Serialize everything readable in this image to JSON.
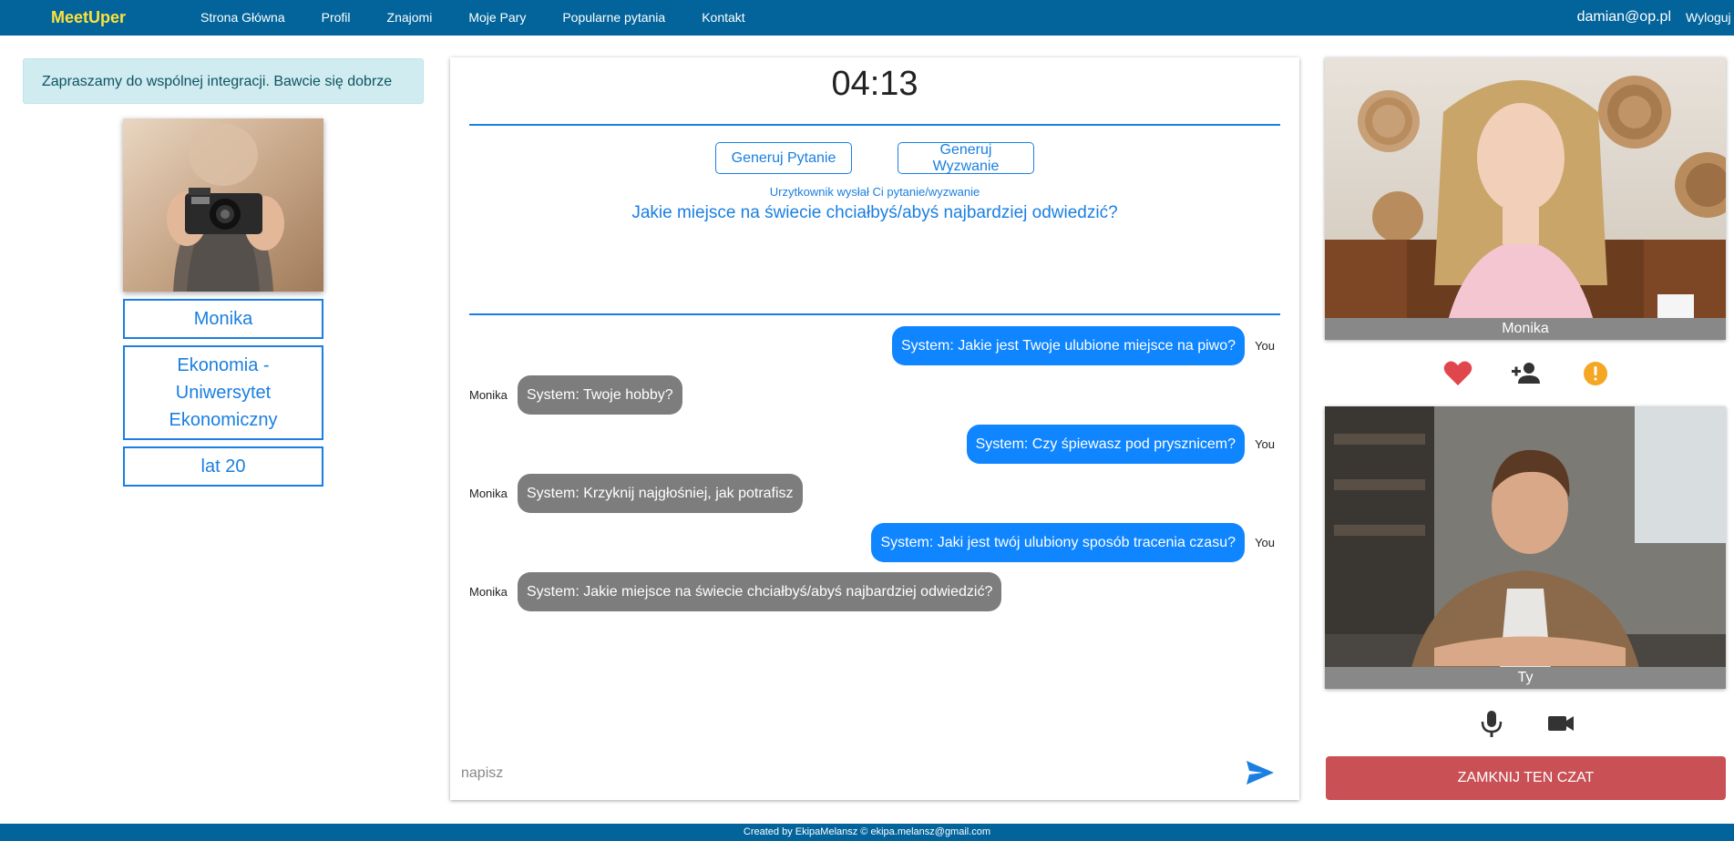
{
  "nav": {
    "brand": "MeetUper",
    "links": [
      "Strona Główna",
      "Profil",
      "Znajomi",
      "Moje Pary",
      "Popularne pytania",
      "Kontakt"
    ],
    "email": "damian@op.pl",
    "logout": "Wyloguj"
  },
  "welcome": "Zapraszamy do wspólnej integracji. Bawcie się dobrze",
  "profile": {
    "name": "Monika",
    "university": "Ekonomia - Uniwersytet Ekonomiczny",
    "age": "lat 20"
  },
  "chat": {
    "timer": "04:13",
    "generate_question": "Generuj Pytanie",
    "generate_challenge": "Generuj Wyzwanie",
    "sent_note": "Urzytkownik wysłał Ci pytanie/wyzwanie",
    "current_question": "Jakie miejsce na świecie chciałbyś/abyś najbardziej odwiedzić?",
    "messages": [
      {
        "from": "you",
        "sender": "You",
        "text": "System: Jakie jest Twoje ulubione miejsce na piwo?"
      },
      {
        "from": "them",
        "sender": "Monika",
        "text": "System: Twoje hobby?"
      },
      {
        "from": "you",
        "sender": "You",
        "text": "System: Czy śpiewasz pod prysznicem?"
      },
      {
        "from": "them",
        "sender": "Monika",
        "text": "System: Krzyknij najgłośniej, jak potrafisz"
      },
      {
        "from": "you",
        "sender": "You",
        "text": "System: Jaki jest twój ulubiony sposób tracenia czasu?"
      },
      {
        "from": "them",
        "sender": "Monika",
        "text": "System: Jakie miejsce na świecie chciałbyś/abyś najbardziej odwiedzić?"
      }
    ],
    "input_placeholder": "napisz",
    "send_icon": "send-icon"
  },
  "video": {
    "partner_label": "Monika",
    "self_label": "Ty"
  },
  "actions": {
    "like_icon": "heart-icon",
    "add_friend_icon": "add-user-icon",
    "report_icon": "alert-icon",
    "mic_icon": "microphone-icon",
    "camera_icon": "video-camera-icon",
    "close_chat": "ZAMKNIJ TEN CZAT"
  },
  "colors": {
    "navbar": "#02649b",
    "brand": "#ffe23a",
    "accent": "#1a7fe0",
    "bubble_you": "#0f85ff",
    "bubble_them": "#7d7d7d",
    "heart": "#e0474c",
    "alert": "#f5a623",
    "close_button": "#c95055"
  },
  "footer": "Created by EkipaMelansz © ekipa.melansz@gmail.com"
}
